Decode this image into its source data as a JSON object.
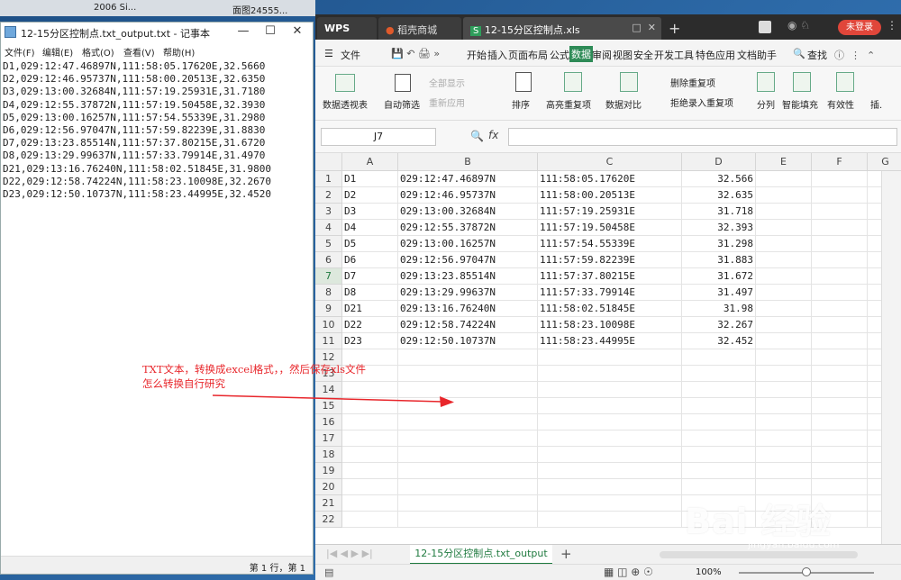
{
  "desktop": {
    "items": [
      "2006 Si...",
      "面图24555..."
    ]
  },
  "notepad": {
    "title": "12-15分区控制点.txt_output.txt - 记事本",
    "menu": [
      "文件(F)",
      "编辑(E)",
      "格式(O)",
      "查看(V)",
      "帮助(H)"
    ],
    "lines": [
      "D1,029:12:47.46897N,111:58:05.17620E,32.5660",
      "D2,029:12:46.95737N,111:58:00.20513E,32.6350",
      "D3,029:13:00.32684N,111:57:19.25931E,31.7180",
      "D4,029:12:55.37872N,111:57:19.50458E,32.3930",
      "D5,029:13:00.16257N,111:57:54.55339E,31.2980",
      "D6,029:12:56.97047N,111:57:59.82239E,31.8830",
      "D7,029:13:23.85514N,111:57:37.80215E,31.6720",
      "D8,029:13:29.99637N,111:57:33.79914E,31.4970",
      "D21,029:13:16.76240N,111:58:02.51845E,31.9800",
      "D22,029:12:58.74224N,111:58:23.10098E,32.2670",
      "D23,029:12:50.10737N,111:58:23.44995E,32.4520"
    ],
    "status": "第 1 行，第 1"
  },
  "wps": {
    "tabs": {
      "wps": "WPS",
      "daoke": "稻壳商城",
      "file": "12-15分区控制点.xls"
    },
    "login": "未登录",
    "menu": {
      "file": "文件",
      "items": [
        "开始",
        "插入",
        "页面布局",
        "公式",
        "数据",
        "审阅",
        "视图",
        "安全",
        "开发工具",
        "特色应用",
        "文档助手"
      ],
      "active": "数据",
      "search": "查找"
    },
    "ribbon": {
      "pivot": "数据透视表",
      "autofilter": "自动筛选",
      "showall": "全部显示",
      "reapply": "重新应用",
      "sort": "排序",
      "highlight": "高亮重复项",
      "compare": "数据对比",
      "remove_dup": "删除重复项",
      "reject_dup": "拒绝录入重复项",
      "split": "分列",
      "flashfill": "智能填充",
      "validity": "有效性",
      "insert": "插."
    },
    "namebox": "J7",
    "fx": "fx",
    "columns": [
      "A",
      "B",
      "C",
      "D",
      "E",
      "F",
      "G"
    ],
    "rows": [
      [
        "D1",
        "029:12:47.46897N",
        "111:58:05.17620E",
        "32.566"
      ],
      [
        "D2",
        "029:12:46.95737N",
        "111:58:00.20513E",
        "32.635"
      ],
      [
        "D3",
        "029:13:00.32684N",
        "111:57:19.25931E",
        "31.718"
      ],
      [
        "D4",
        "029:12:55.37872N",
        "111:57:19.50458E",
        "32.393"
      ],
      [
        "D5",
        "029:13:00.16257N",
        "111:57:54.55339E",
        "31.298"
      ],
      [
        "D6",
        "029:12:56.97047N",
        "111:57:59.82239E",
        "31.883"
      ],
      [
        "D7",
        "029:13:23.85514N",
        "111:57:37.80215E",
        "31.672"
      ],
      [
        "D8",
        "029:13:29.99637N",
        "111:57:33.79914E",
        "31.497"
      ],
      [
        "D21",
        "029:13:16.76240N",
        "111:58:02.51845E",
        "31.98"
      ],
      [
        "D22",
        "029:12:58.74224N",
        "111:58:23.10098E",
        "32.267"
      ],
      [
        "D23",
        "029:12:50.10737N",
        "111:58:23.44995E",
        "32.452"
      ]
    ],
    "row_numbers": [
      "1",
      "2",
      "3",
      "4",
      "5",
      "6",
      "7",
      "8",
      "9",
      "10",
      "11",
      "12",
      "13",
      "14",
      "15",
      "16",
      "17",
      "18",
      "19",
      "20",
      "21",
      "22"
    ],
    "sheet_tab": "12-15分区控制点.txt_output",
    "zoom": "100%"
  },
  "annotation": {
    "line1": "TXT文本，转换成excel格式，，然后保存xls文件",
    "line2": "怎么转换自行研究"
  },
  "watermark": {
    "main": "Bai 经验",
    "sub": "jingyan.baidu.com"
  }
}
